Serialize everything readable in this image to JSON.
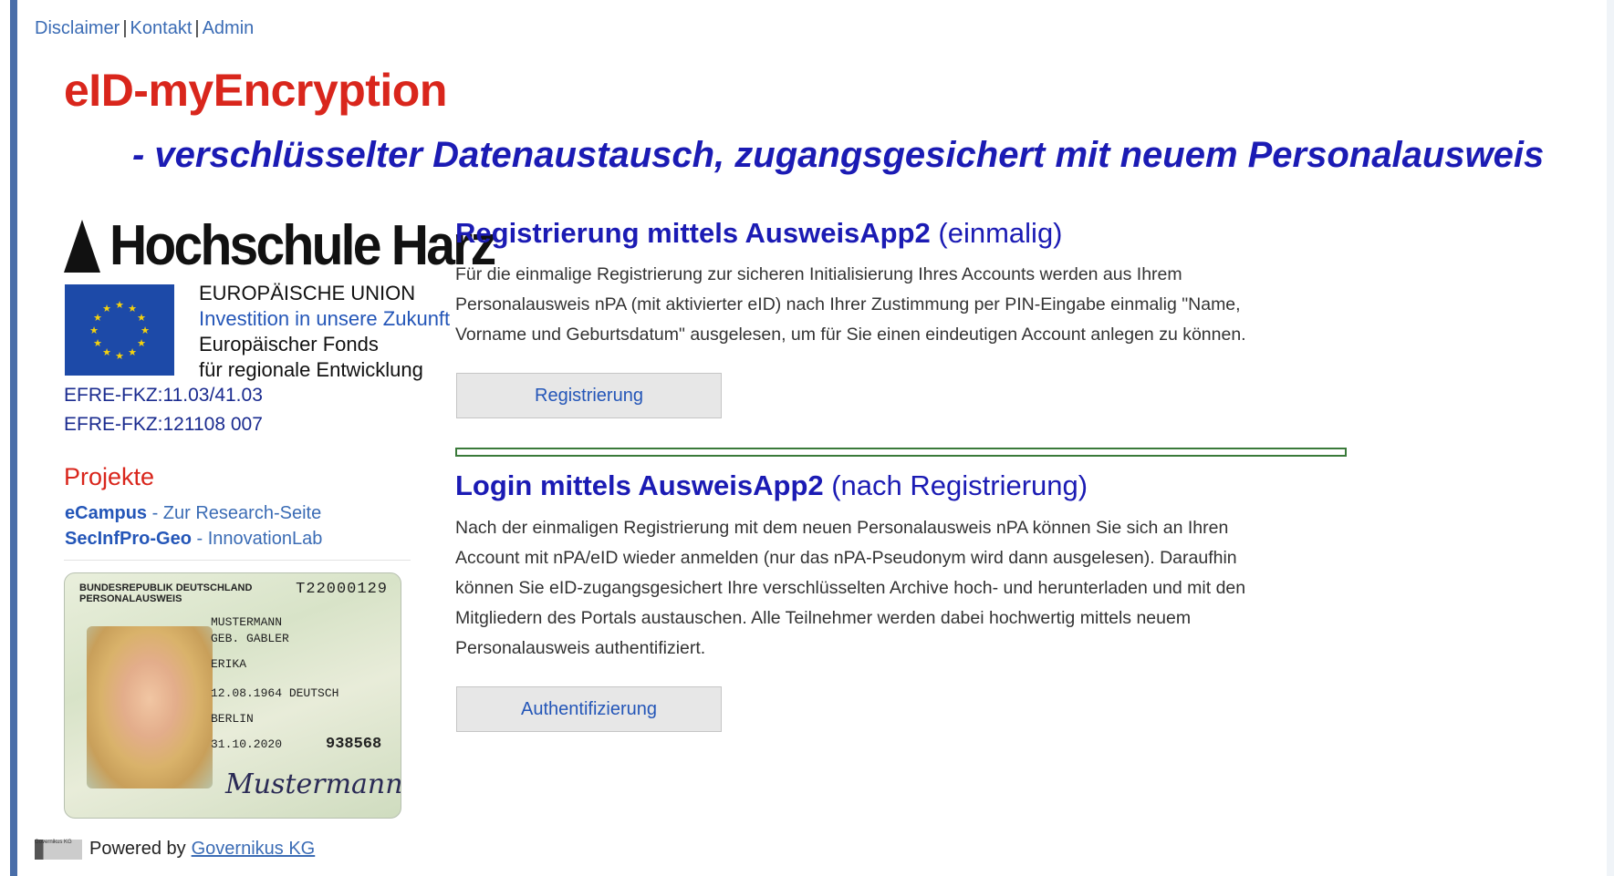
{
  "nav": {
    "disclaimer": "Disclaimer",
    "kontakt": "Kontakt",
    "admin": "Admin",
    "separator": "|"
  },
  "header": {
    "title": "eID-myEncryption",
    "subtitle": "- verschlüsselter Datenaustausch, zugangsgesichert mit neuem Personalausweis"
  },
  "sidebar": {
    "logo_text": "Hochschule Harz",
    "eu": {
      "line1": "EUROPÄISCHE UNION",
      "line2": "Investition in unsere Zukunft",
      "line3": "Europäischer Fonds",
      "line4": "für regionale Entwicklung"
    },
    "efre1": "EFRE-FKZ:11.03/41.03",
    "efre2": "EFRE-FKZ:121108 007",
    "projects_heading": "Projekte",
    "projects": [
      {
        "name": "eCampus",
        "desc": " - Zur Research-Seite"
      },
      {
        "name": "SecInfPro-Geo",
        "desc": " - InnovationLab"
      }
    ],
    "id_card": {
      "header": "BUNDESREPUBLIK DEUTSCHLAND",
      "subheader": "PERSONALAUSWEIS",
      "number": "T22000129",
      "surname": "MUSTERMANN",
      "birthname": "GEB. GABLER",
      "given": "ERIKA",
      "birth": "12.08.1964 DEUTSCH",
      "place": "BERLIN",
      "expiry": "31.10.2020",
      "code": "938568",
      "signature": "Mustermann"
    },
    "powered_prefix": "Powered by",
    "powered_link": "Governikus KG",
    "powered_logo_text": "Governikus KG"
  },
  "registration": {
    "title_bold": "Registrierung mittels AusweisApp2",
    "title_rest": " (einmalig)",
    "text": "Für die einmalige Registrierung zur sicheren Initialisierung Ihres Accounts werden aus Ihrem Personalausweis nPA (mit aktivierter eID) nach Ihrer Zustimmung per PIN-Eingabe einmalig \"Name, Vorname und Geburtsdatum\" ausgelesen, um für Sie einen eindeutigen Account anlegen zu können.",
    "button": "Registrierung"
  },
  "login": {
    "title_bold": "Login mittels AusweisApp2",
    "title_rest": " (nach Registrierung)",
    "text": "Nach der einmaligen Registrierung mit dem neuen Personalausweis nPA können Sie sich an Ihren Account mit nPA/eID wieder anmelden (nur das nPA-Pseudonym wird dann ausgelesen). Daraufhin können Sie eID-zugangsgesichert Ihre verschlüsselten Archive hoch- und herunterladen und mit den Mitgliedern des Portals austauschen. Alle Teilnehmer werden dabei hochwertig mittels neuem Personalausweis authentifiziert.",
    "button": "Authentifizierung"
  },
  "colors": {
    "title_red": "#d9261c",
    "subtitle_blue": "#1b1bb4",
    "link_blue": "#3b6cb5",
    "separator_green": "#3a7a3a"
  }
}
